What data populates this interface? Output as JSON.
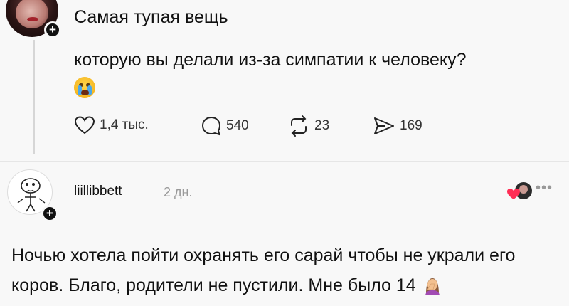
{
  "post": {
    "title": "Самая тупая вещь",
    "body": "которую вы делали из-за симпатии к человеку?",
    "emoji": "crying-face",
    "likes": "1,4 тыс.",
    "comments": "540",
    "reposts": "23",
    "shares": "169"
  },
  "reply": {
    "username": "liillibbett",
    "time": "2 дн.",
    "text": "Ночью хотела пойти охранять его сарай чтобы не украли его коров. Благо, родители не пустили. Мне было 14",
    "emoji": "woman-facepalming"
  },
  "icons": {
    "like": "heart-icon",
    "comment": "comment-bubble-icon",
    "repost": "repost-icon",
    "share": "send-icon",
    "follow": "plus-icon",
    "more": "more-dots-icon"
  },
  "colors": {
    "background": "#f8f8f8",
    "text": "#111111",
    "muted": "#999999"
  }
}
